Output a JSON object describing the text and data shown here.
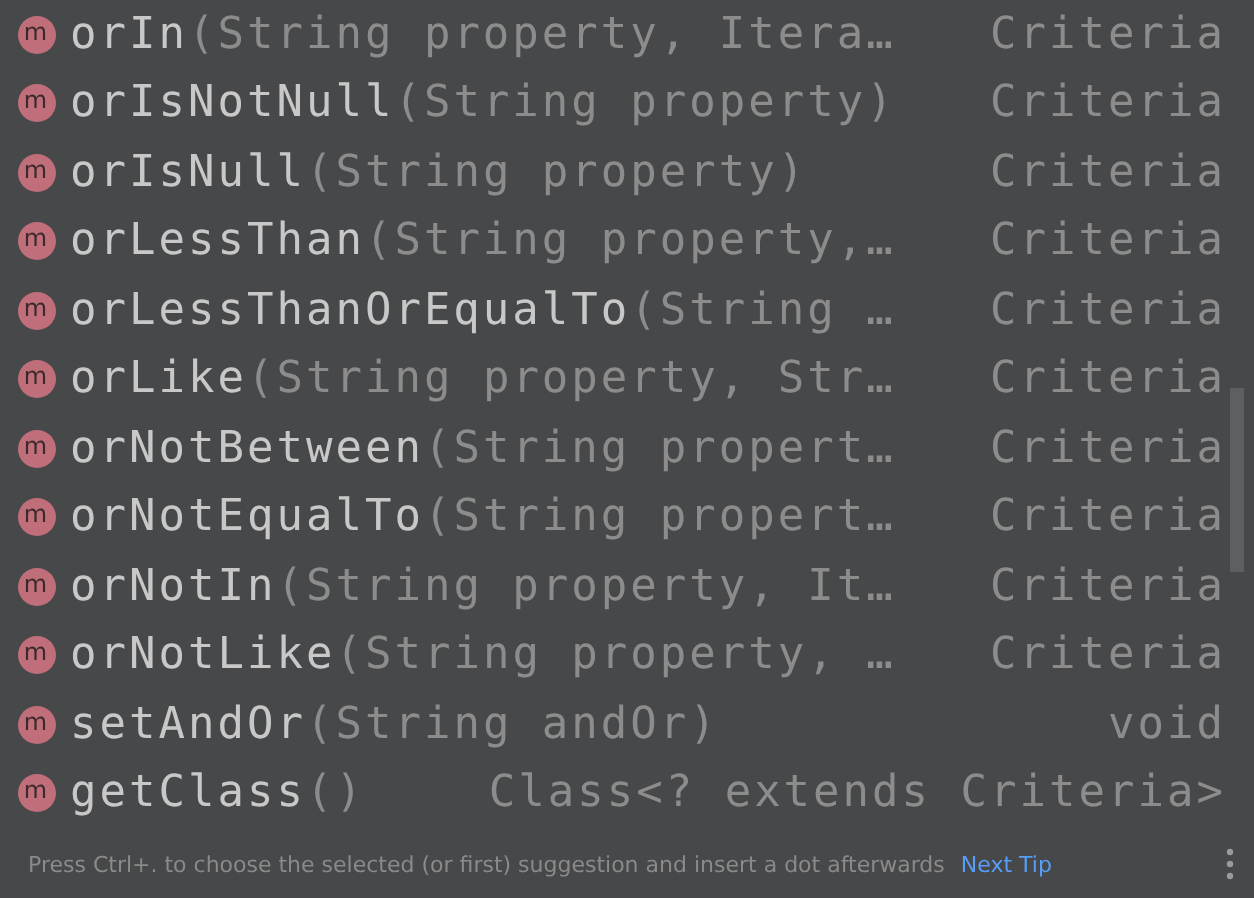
{
  "suggestions": [
    {
      "icon_letter": "m",
      "name": "orIn",
      "params": "(String property, Itera…",
      "type": "Criteria"
    },
    {
      "icon_letter": "m",
      "name": "orIsNotNull",
      "params": "(String property)",
      "type": "Criteria"
    },
    {
      "icon_letter": "m",
      "name": "orIsNull",
      "params": "(String property)",
      "type": "Criteria"
    },
    {
      "icon_letter": "m",
      "name": "orLessThan",
      "params": "(String property,…",
      "type": "Criteria"
    },
    {
      "icon_letter": "m",
      "name": "orLessThanOrEqualTo",
      "params": "(String …",
      "type": "Criteria"
    },
    {
      "icon_letter": "m",
      "name": "orLike",
      "params": "(String property, Str…",
      "type": "Criteria"
    },
    {
      "icon_letter": "m",
      "name": "orNotBetween",
      "params": "(String propert…",
      "type": "Criteria"
    },
    {
      "icon_letter": "m",
      "name": "orNotEqualTo",
      "params": "(String propert…",
      "type": "Criteria"
    },
    {
      "icon_letter": "m",
      "name": "orNotIn",
      "params": "(String property, It…",
      "type": "Criteria"
    },
    {
      "icon_letter": "m",
      "name": "orNotLike",
      "params": "(String property, …",
      "type": "Criteria"
    },
    {
      "icon_letter": "m",
      "name": "setAndOr",
      "params": "(String andOr)",
      "type": "void"
    },
    {
      "icon_letter": "m",
      "name": "getClass",
      "params": "()",
      "type": "Class<? extends Criteria>"
    }
  ],
  "footer": {
    "hint": "Press Ctrl+. to choose the selected (or first) suggestion and insert a dot afterwards",
    "link": "Next Tip"
  }
}
